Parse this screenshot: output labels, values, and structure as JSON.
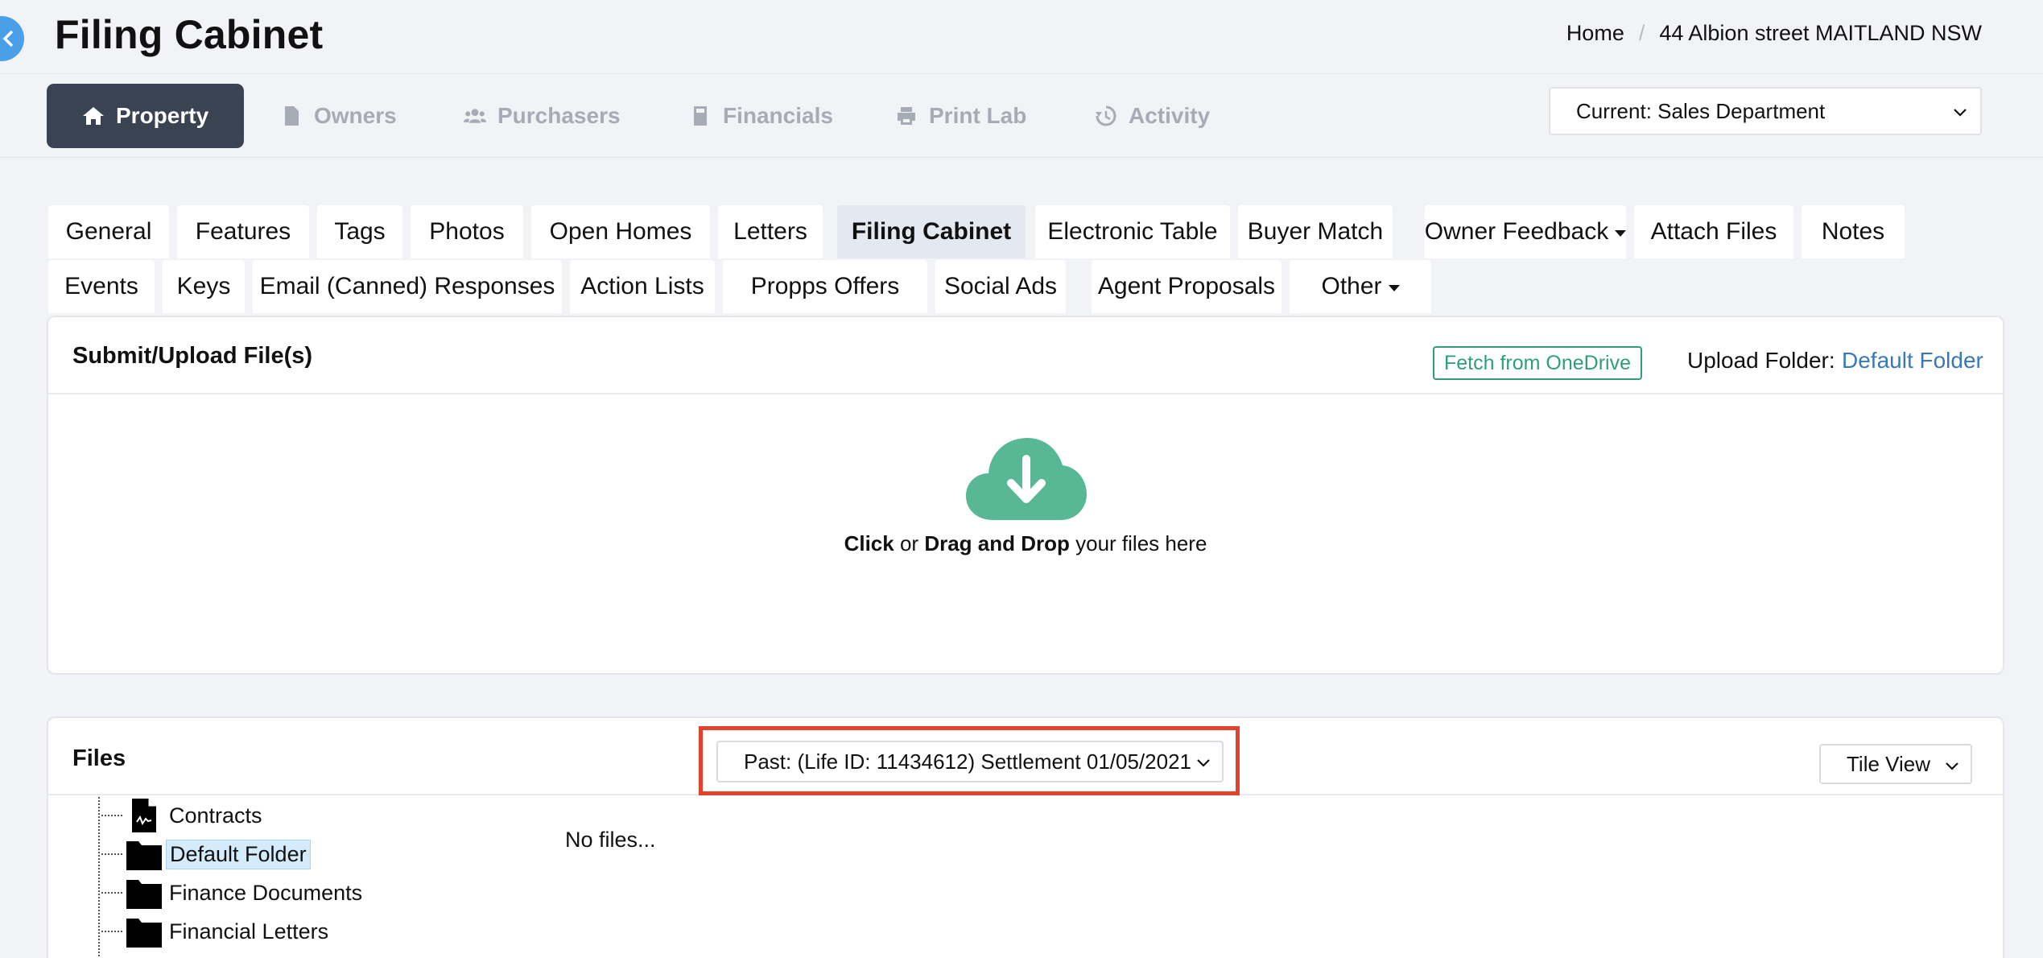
{
  "header": {
    "title": "Filing Cabinet",
    "breadcrumb": {
      "home": "Home",
      "separator": "/",
      "current": "44 Albion street MAITLAND NSW"
    }
  },
  "main_nav": {
    "items": [
      {
        "label": "Property",
        "icon": "home-icon",
        "active": true
      },
      {
        "label": "Owners",
        "icon": "file-icon"
      },
      {
        "label": "Purchasers",
        "icon": "users-icon"
      },
      {
        "label": "Financials",
        "icon": "calculator-icon"
      },
      {
        "label": "Print Lab",
        "icon": "printer-icon"
      },
      {
        "label": "Activity",
        "icon": "history-icon"
      }
    ],
    "department_select": "Current: Sales Department"
  },
  "tabs": {
    "row1": [
      "General",
      "Features",
      "Tags",
      "Photos",
      "Open Homes",
      "Letters",
      "Filing Cabinet",
      "Electronic Table",
      "Buyer Match",
      "Owner Feedback",
      "Attach Files",
      "Notes"
    ],
    "row2": [
      "Events",
      "Keys",
      "Email (Canned) Responses",
      "Action Lists",
      "Propps Offers",
      "Social Ads",
      "Agent Proposals",
      "Other"
    ],
    "active": "Filing Cabinet"
  },
  "upload": {
    "title": "Submit/Upload File(s)",
    "onedrive_button": "Fetch from OneDrive",
    "folder_label": "Upload Folder:",
    "folder_value": "Default Folder",
    "drop_click": "Click",
    "drop_or": " or ",
    "drop_drag": "Drag and Drop",
    "drop_rest": " your files here"
  },
  "files": {
    "title": "Files",
    "life_select": "Past: (Life ID: 11434612) Settlement 01/05/2021",
    "view_select": "Tile View",
    "empty_text": "No files...",
    "tree": [
      {
        "label": "Contracts",
        "icon": "contract-file-icon"
      },
      {
        "label": "Default Folder",
        "icon": "folder-icon",
        "selected": true
      },
      {
        "label": "Finance Documents",
        "icon": "folder-icon"
      },
      {
        "label": "Financial Letters",
        "icon": "folder-icon"
      }
    ]
  },
  "colors": {
    "active_nav_bg": "#3a4352",
    "accent_green": "#2f9e7a",
    "cloud_green": "#58b896",
    "link_blue": "#3a78b8",
    "highlight_red": "#e2432c",
    "back_button_blue": "#4aa0e8"
  }
}
